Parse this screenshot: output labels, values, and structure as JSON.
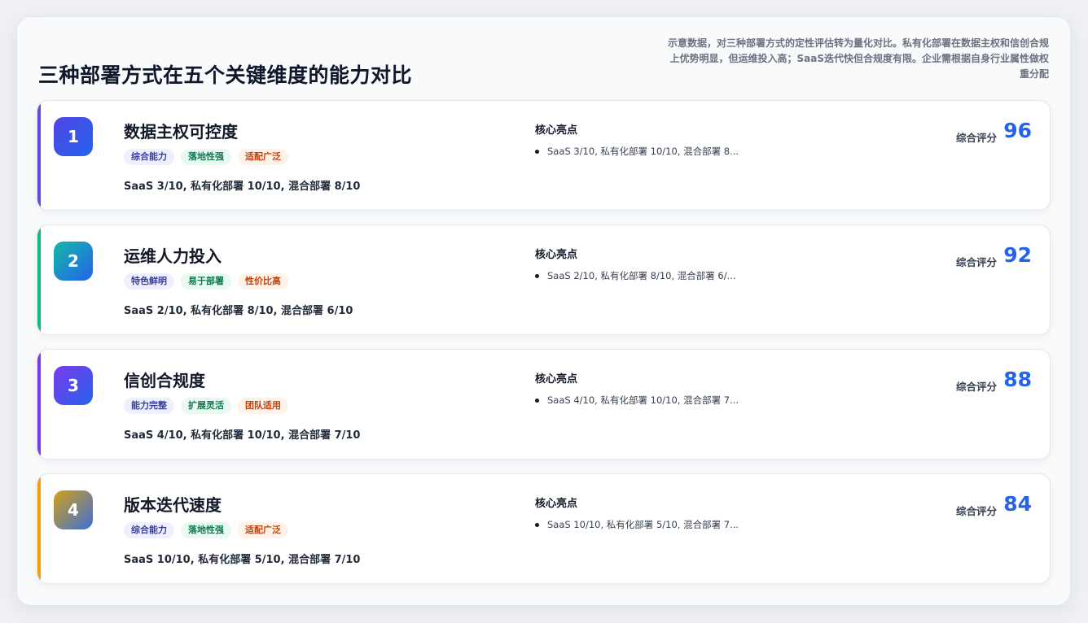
{
  "header": {
    "title": "三种部署方式在五个关键维度的能力对比",
    "description": "示意数据，对三种部署方式的定性评估转为量化对比。私有化部署在数据主权和信创合规上优势明显，但运维投入高；SaaS迭代快但合规度有限。企业需根据自身行业属性做权重分配"
  },
  "highlight_heading": "核心亮点",
  "score_label": "综合评分",
  "colors": {
    "score": "#2563eb",
    "tag_bg": [
      "#eef0ff",
      "#e9f8f1",
      "#fff2e8"
    ],
    "tag_fg": [
      "#3b3f9c",
      "#0d7a4e",
      "#c2410c"
    ]
  },
  "cards": [
    {
      "rank": "1",
      "title": "数据主权可控度",
      "tags": [
        "综合能力",
        "落地性强",
        "适配广泛"
      ],
      "summary": "SaaS 3/10, 私有化部署 10/10, 混合部署 8/10",
      "highlight": "SaaS 3/10, 私有化部署 10/10, 混合部署 8...",
      "score": "96",
      "accent_color": "#5b4ee0",
      "badge_gradient": [
        "#4f46e5",
        "#2563eb"
      ]
    },
    {
      "rank": "2",
      "title": "运维人力投入",
      "tags": [
        "特色鲜明",
        "易于部署",
        "性价比高"
      ],
      "summary": "SaaS 2/10, 私有化部署 8/10, 混合部署 6/10",
      "highlight": "SaaS 2/10, 私有化部署 8/10, 混合部署 6/...",
      "score": "92",
      "accent_color": "#10b981",
      "badge_gradient": [
        "#14b8a6",
        "#2563eb"
      ]
    },
    {
      "rank": "3",
      "title": "信创合规度",
      "tags": [
        "能力完整",
        "扩展灵活",
        "团队适用"
      ],
      "summary": "SaaS 4/10, 私有化部署 10/10, 混合部署 7/10",
      "highlight": "SaaS 4/10, 私有化部署 10/10, 混合部署 7...",
      "score": "88",
      "accent_color": "#7c3aed",
      "badge_gradient": [
        "#7c3aed",
        "#2563eb"
      ]
    },
    {
      "rank": "4",
      "title": "版本迭代速度",
      "tags": [
        "综合能力",
        "落地性强",
        "适配广泛"
      ],
      "summary": "SaaS 10/10, 私有化部署 5/10, 混合部署 7/10",
      "highlight": "SaaS 10/10, 私有化部署 5/10, 混合部署 7...",
      "score": "84",
      "accent_color": "#f59e0b",
      "badge_gradient": [
        "#d4a017",
        "#3b6fd8"
      ]
    }
  ]
}
